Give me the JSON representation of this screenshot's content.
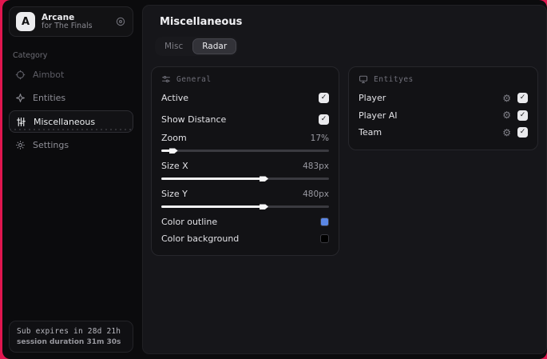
{
  "app": {
    "logo_letter": "A",
    "name": "Arcane",
    "subtitle": "for The Finals"
  },
  "sidebar": {
    "category_label": "Category",
    "items": [
      {
        "label": "Aimbot"
      },
      {
        "label": "Entities"
      },
      {
        "label": "Miscellaneous"
      },
      {
        "label": "Settings"
      }
    ],
    "footer": {
      "sub_expires": "Sub expires in 28d 21h",
      "session_duration": "session duration 31m 30s"
    }
  },
  "main": {
    "title": "Miscellaneous",
    "tabs": [
      {
        "label": "Misc",
        "active": false
      },
      {
        "label": "Radar",
        "active": true
      }
    ],
    "general": {
      "title": "General",
      "checkbox_rows": [
        {
          "label": "Active",
          "checked": true
        },
        {
          "label": "Show Distance",
          "checked": true
        }
      ],
      "sliders": [
        {
          "label": "Zoom",
          "value": "17%",
          "fill": "6%"
        },
        {
          "label": "Size X",
          "value": "483px",
          "fill": "60%"
        },
        {
          "label": "Size Y",
          "value": "480px",
          "fill": "60%"
        }
      ],
      "color_rows": [
        {
          "label": "Color outline",
          "color": "#5b87e5"
        },
        {
          "label": "Color background",
          "color": "#000000"
        }
      ]
    },
    "entities": {
      "title": "Entityes",
      "rows": [
        {
          "label": "Player",
          "checked": true
        },
        {
          "label": "Player AI",
          "checked": true
        },
        {
          "label": "Team",
          "checked": true
        }
      ]
    }
  },
  "icons": {
    "check": "✓",
    "gear": "⚙"
  },
  "colors": {
    "backdrop": "#e0164f",
    "window_bg": "#0b0b0d",
    "panel_bg": "#16161a",
    "outline_swatch": "#5b87e5",
    "background_swatch": "#000000"
  }
}
